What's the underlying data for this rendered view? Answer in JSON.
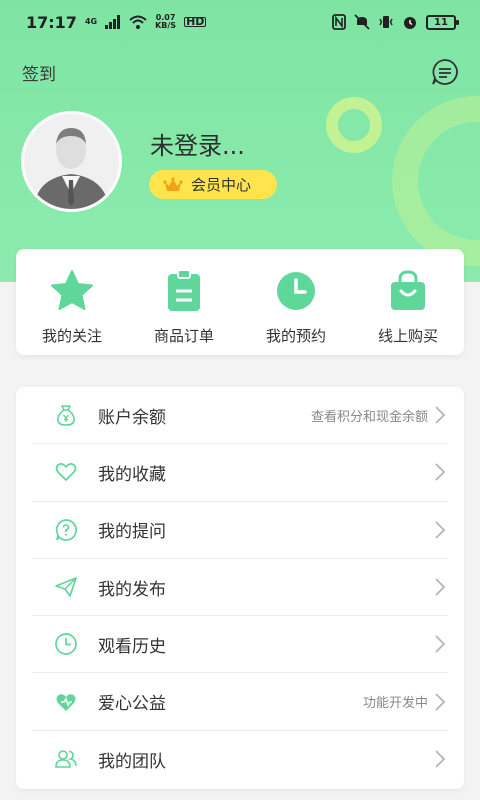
{
  "status_bar": {
    "time": "17:17",
    "network_type": "4G",
    "speed_value": "0.07",
    "speed_unit": "KB/S",
    "hd_label": "HD",
    "battery": "11"
  },
  "header": {
    "signin_label": "签到",
    "username": "未登录...",
    "member_center_label": "会员中心"
  },
  "colors": {
    "accent": "#5fd69a",
    "header_bg": "#86e9a9",
    "badge_bg": "#ffe44d",
    "crown": "#f2a11a"
  },
  "quick_actions": [
    {
      "label": "我的关注",
      "icon": "star-icon"
    },
    {
      "label": "商品订单",
      "icon": "clipboard-icon"
    },
    {
      "label": "我的预约",
      "icon": "clock-icon"
    },
    {
      "label": "线上购买",
      "icon": "shopping-bag-icon"
    }
  ],
  "menu": [
    {
      "label": "账户余额",
      "hint": "查看积分和现金余额",
      "icon": "money-bag-icon"
    },
    {
      "label": "我的收藏",
      "hint": "",
      "icon": "heart-icon"
    },
    {
      "label": "我的提问",
      "hint": "",
      "icon": "question-bubble-icon"
    },
    {
      "label": "我的发布",
      "hint": "",
      "icon": "paper-plane-icon"
    },
    {
      "label": "观看历史",
      "hint": "",
      "icon": "history-clock-icon"
    },
    {
      "label": "爱心公益",
      "hint": "功能开发中",
      "icon": "charity-heart-icon"
    },
    {
      "label": "我的团队",
      "hint": "",
      "icon": "team-icon"
    }
  ]
}
